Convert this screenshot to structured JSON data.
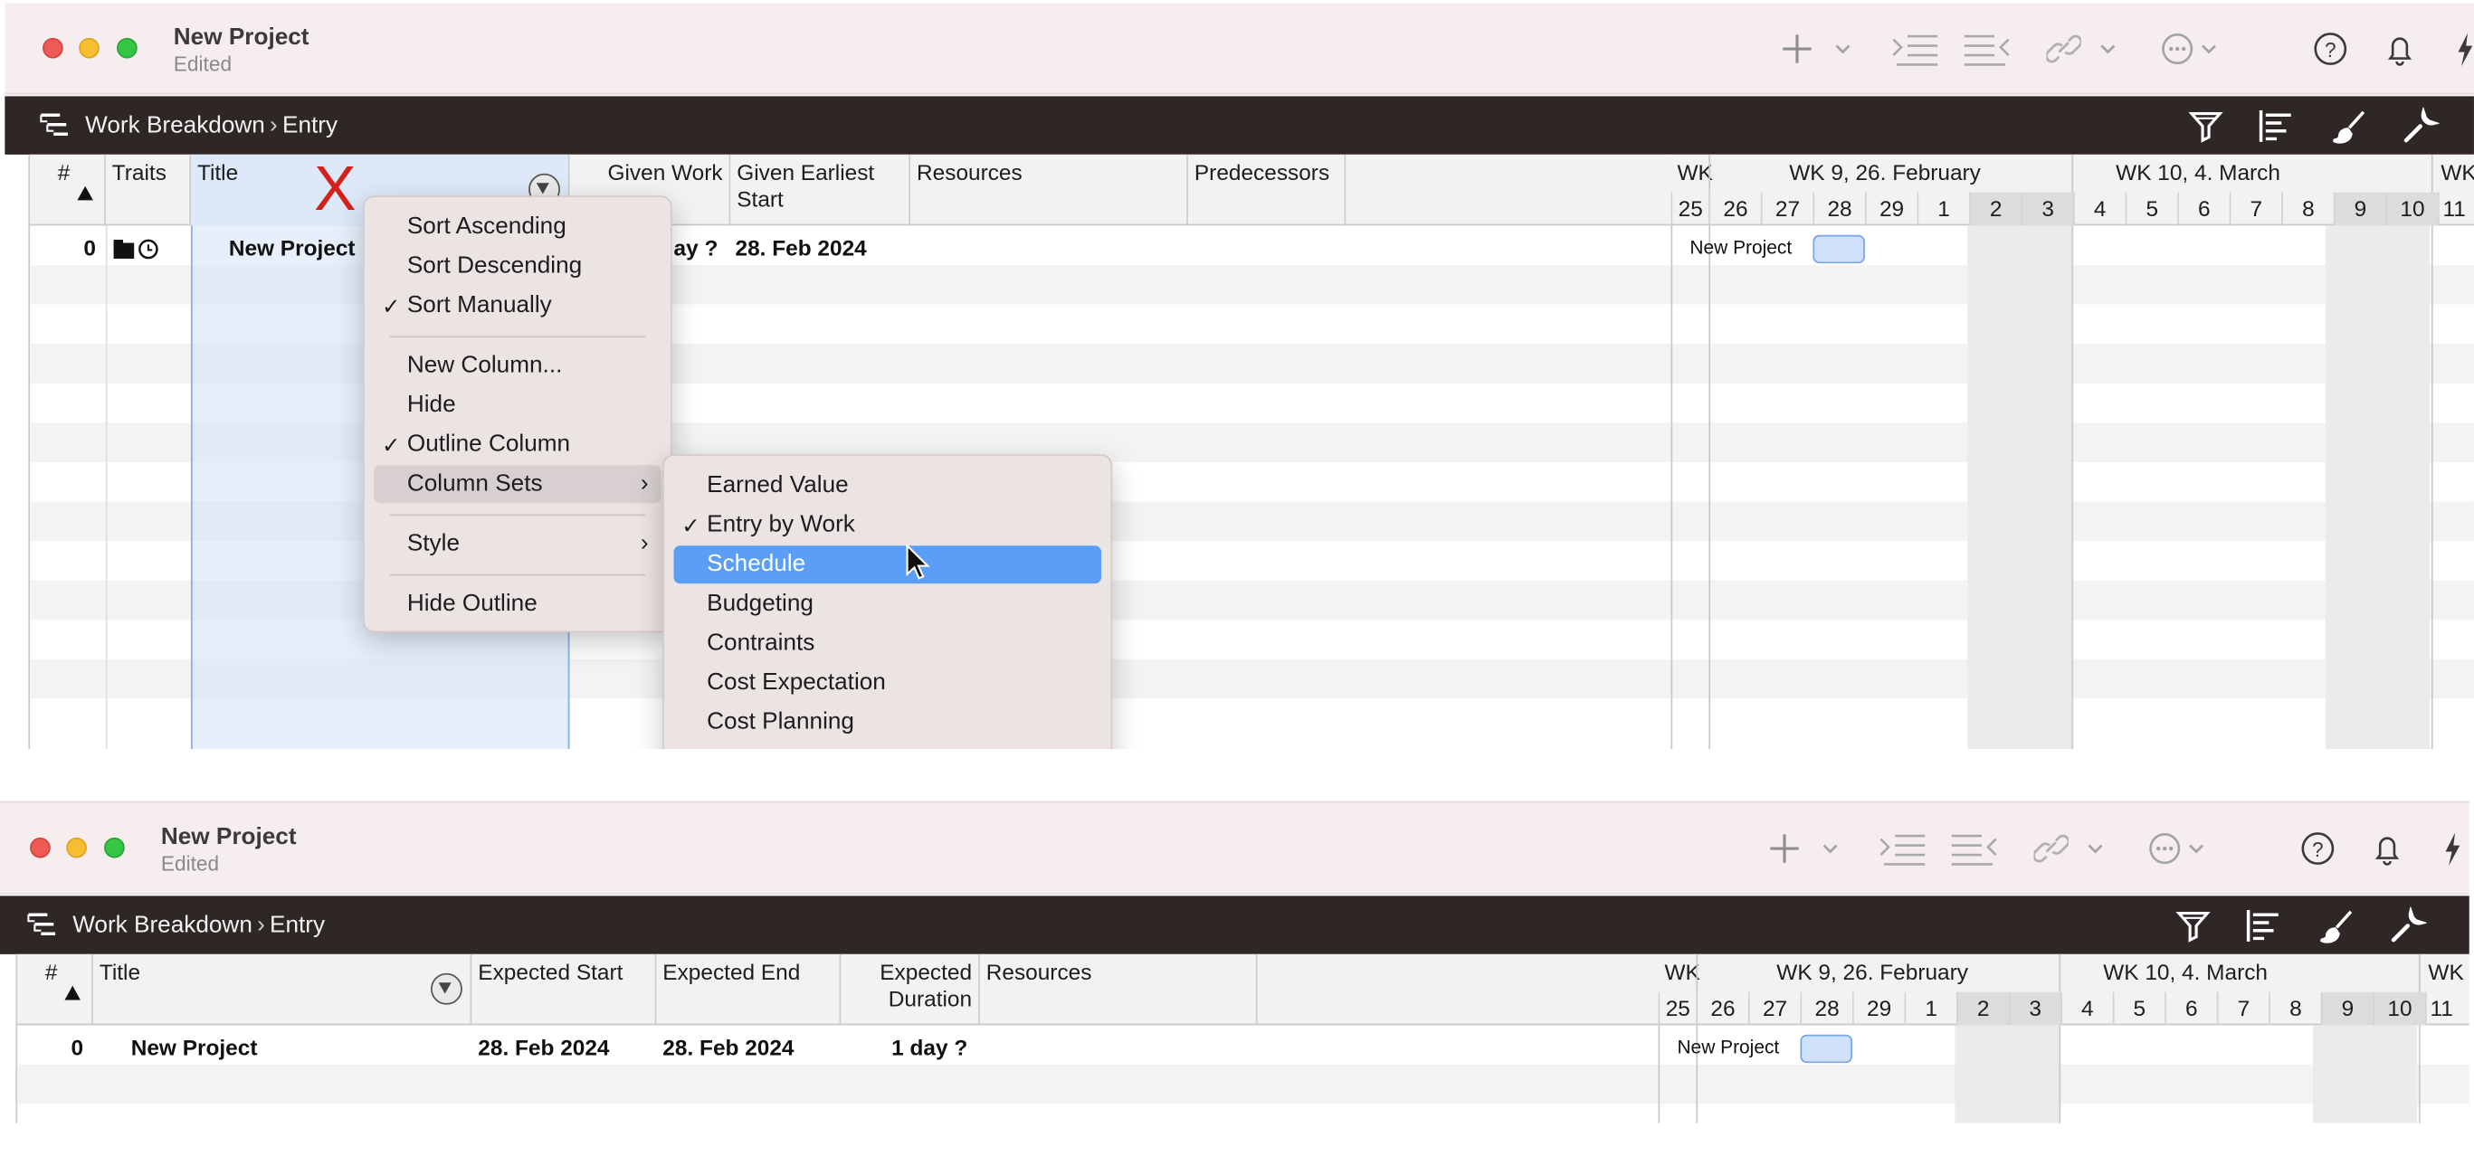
{
  "window1": {
    "title": "New Project",
    "subtitle": "Edited",
    "breadcrumb": {
      "part1": "Work Breakdown",
      "part2": "Entry"
    },
    "columns": {
      "num": "#",
      "traits": "Traits",
      "title": "Title",
      "given_work": "Given Work",
      "given_earliest_start": "Given Earliest\nStart",
      "resources": "Resources",
      "predecessors": "Predecessors"
    },
    "row0": {
      "num": "0",
      "title": "New Project",
      "given_work": "ay ?",
      "given_earliest_start": "28. Feb 2024"
    },
    "annotation": "X",
    "context_menu": {
      "sort_ascending": "Sort Ascending",
      "sort_descending": "Sort Descending",
      "sort_manually": "Sort Manually",
      "new_column": "New Column...",
      "hide": "Hide",
      "outline_column": "Outline Column",
      "column_sets": "Column Sets",
      "style": "Style",
      "hide_outline": "Hide Outline",
      "checked": [
        "Sort Manually",
        "Outline Column"
      ]
    },
    "submenu": {
      "items": [
        "Earned Value",
        "Entry by Work",
        "Schedule",
        "Budgeting",
        "Contraints",
        "Cost Expectation",
        "Cost Planning"
      ],
      "checked": "Entry by Work",
      "highlighted": "Schedule"
    }
  },
  "window2": {
    "title": "New Project",
    "subtitle": "Edited",
    "breadcrumb": {
      "part1": "Work Breakdown",
      "part2": "Entry"
    },
    "columns": {
      "num": "#",
      "title": "Title",
      "expected_start": "Expected Start",
      "expected_end": "Expected End",
      "expected_duration": "Expected\nDuration",
      "resources": "Resources"
    },
    "row0": {
      "num": "0",
      "title": "New Project",
      "expected_start": "28. Feb 2024",
      "expected_end": "28. Feb 2024",
      "expected_duration": "1 day ?"
    }
  },
  "gantt": {
    "wk_left": "WK",
    "wk9": "WK 9, 26. February",
    "wk10": "WK 10, 4. March",
    "wk_right": "WK",
    "days": [
      "25",
      "26",
      "27",
      "28",
      "29",
      "1",
      "2",
      "3",
      "4",
      "5",
      "6",
      "7",
      "8",
      "9",
      "10",
      "11"
    ],
    "bar_label": "New Project"
  },
  "colors": {
    "accent": "#5a9ff5",
    "pathbar": "#2f2626",
    "titlebar": "#f6eeee",
    "task_bar": "#cfe0fa"
  }
}
